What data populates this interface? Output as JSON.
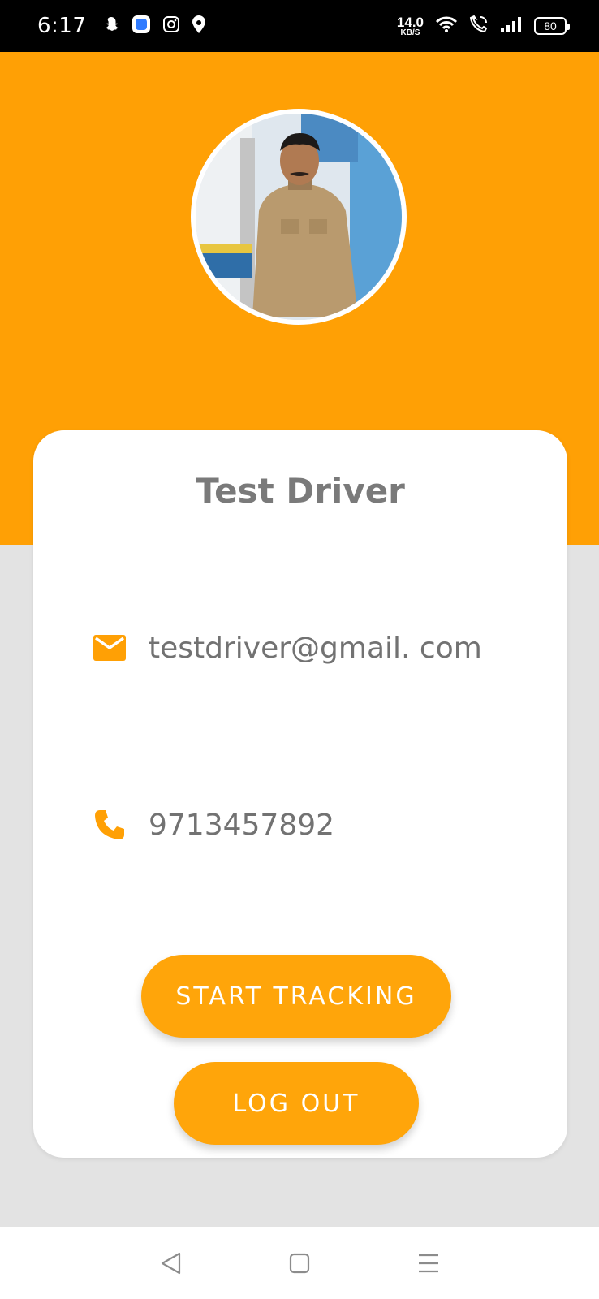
{
  "status_bar": {
    "time": "6:17",
    "netspeed_value": "14.0",
    "netspeed_unit": "KB/S",
    "battery": "80",
    "notification_icons": [
      "snapchat-icon",
      "app-icon",
      "instagram-icon",
      "swiggy-icon"
    ],
    "system_icons": [
      "wifi-icon",
      "wifi-calling-icon",
      "signal-icon",
      "battery-icon"
    ]
  },
  "profile": {
    "name": "Test Driver",
    "email": "testdriver@gmail. com",
    "phone": "9713457892",
    "email_icon": "mail-icon",
    "phone_icon": "phone-icon"
  },
  "actions": {
    "start_tracking_label": "START TRACKING",
    "logout_label": "LOG OUT"
  },
  "nav": [
    "back-icon",
    "home-icon",
    "menu-icon"
  ],
  "colors": {
    "accent": "#ffa005",
    "background": "#e3e3e3",
    "text_gray": "#727272"
  }
}
